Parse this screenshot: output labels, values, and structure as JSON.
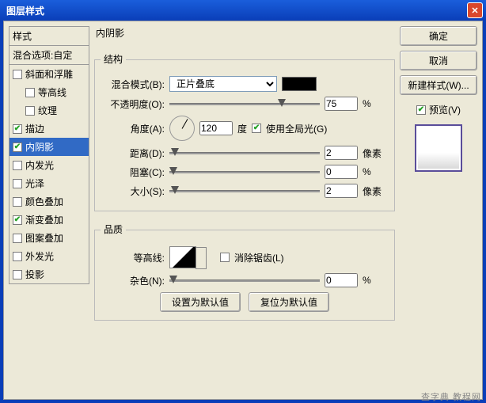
{
  "window": {
    "title": "图层样式"
  },
  "left": {
    "hdr_style": "样式",
    "hdr_blend": "混合选项:自定",
    "items": [
      {
        "label": "斜面和浮雕",
        "checked": false,
        "indent": false
      },
      {
        "label": "等高线",
        "checked": false,
        "indent": true
      },
      {
        "label": "纹理",
        "checked": false,
        "indent": true
      },
      {
        "label": "描边",
        "checked": true,
        "indent": false
      },
      {
        "label": "内阴影",
        "checked": true,
        "indent": false,
        "selected": true
      },
      {
        "label": "内发光",
        "checked": false,
        "indent": false
      },
      {
        "label": "光泽",
        "checked": false,
        "indent": false
      },
      {
        "label": "颜色叠加",
        "checked": false,
        "indent": false
      },
      {
        "label": "渐变叠加",
        "checked": true,
        "indent": false
      },
      {
        "label": "图案叠加",
        "checked": false,
        "indent": false
      },
      {
        "label": "外发光",
        "checked": false,
        "indent": false
      },
      {
        "label": "投影",
        "checked": false,
        "indent": false
      }
    ]
  },
  "mid": {
    "title": "内阴影",
    "sec_struct": "结构",
    "sec_quality": "品质",
    "lbl_blendmode": "混合模式(B):",
    "val_blendmode": "正片叠底",
    "lbl_opacity": "不透明度(O):",
    "val_opacity": "75",
    "unit_pct": "%",
    "lbl_angle": "角度(A):",
    "val_angle": "120",
    "unit_deg": "度",
    "lbl_global": "使用全局光(G)",
    "chk_global": true,
    "lbl_distance": "距离(D):",
    "val_distance": "2",
    "unit_px": "像素",
    "lbl_choke": "阻塞(C):",
    "val_choke": "0",
    "lbl_size": "大小(S):",
    "val_size": "2",
    "lbl_contour": "等高线:",
    "lbl_antialias": "消除锯齿(L)",
    "chk_antialias": false,
    "lbl_noise": "杂色(N):",
    "val_noise": "0",
    "btn_default": "设置为默认值",
    "btn_reset": "复位为默认值"
  },
  "right": {
    "btn_ok": "确定",
    "btn_cancel": "取消",
    "btn_newstyle": "新建样式(W)...",
    "lbl_preview": "预览(V)",
    "chk_preview": true
  },
  "watermark": "查字典 教程网"
}
